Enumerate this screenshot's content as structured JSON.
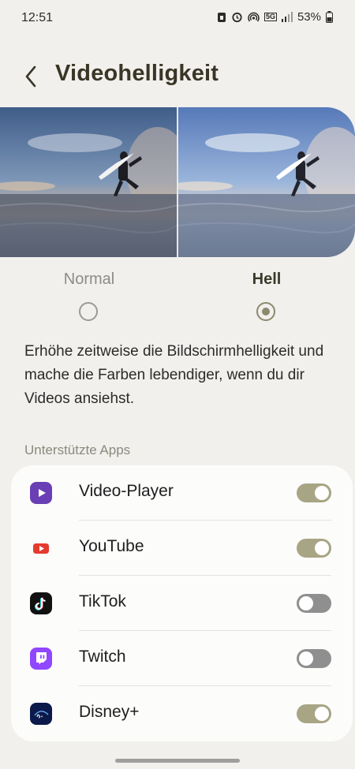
{
  "status_bar": {
    "time": "12:51",
    "network": "5G",
    "battery": "53%"
  },
  "header": {
    "title": "Videohelligkeit"
  },
  "options": {
    "normal": {
      "label": "Normal",
      "selected": false
    },
    "hell": {
      "label": "Hell",
      "selected": true
    }
  },
  "description": "Erhöhe zeitweise die Bildschirmhelligkeit und mache die Farben lebendiger, wenn du dir Videos ansiehst.",
  "section_title": "Unterstützte Apps",
  "apps": [
    {
      "name": "Video-Player",
      "enabled": true,
      "icon": "video-player-icon"
    },
    {
      "name": "YouTube",
      "enabled": true,
      "icon": "youtube-icon"
    },
    {
      "name": "TikTok",
      "enabled": false,
      "icon": "tiktok-icon"
    },
    {
      "name": "Twitch",
      "enabled": false,
      "icon": "twitch-icon"
    },
    {
      "name": "Disney+",
      "enabled": true,
      "icon": "disney-plus-icon"
    }
  ],
  "colors": {
    "accent": "#a8a585",
    "toggle_off": "#8f8f8f",
    "background": "#f1f0ed"
  }
}
